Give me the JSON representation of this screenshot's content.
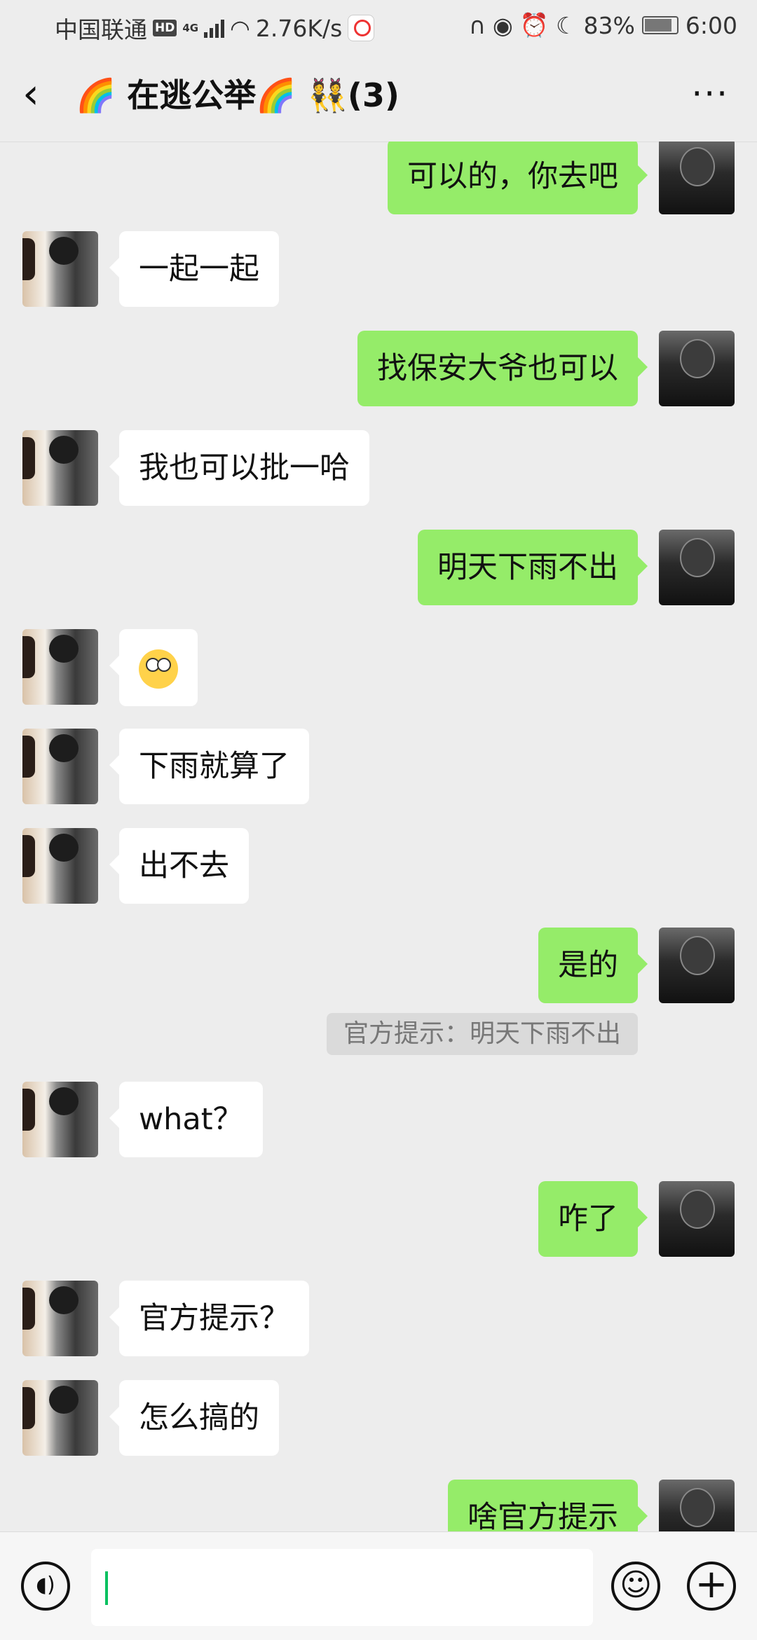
{
  "status_bar": {
    "carrier": "中国联通",
    "hd": "HD",
    "network": "4G",
    "speed": "2.76K/s",
    "battery": "83%",
    "time": "6:00",
    "icons": [
      "headphones-icon",
      "eye-icon",
      "alarm-icon",
      "moon-icon",
      "battery-icon",
      "wifi-icon",
      "signal-icon"
    ]
  },
  "nav": {
    "back_icon": "‹",
    "title": "🌈 在逃公举🌈 👯(3)",
    "more_icon": "···"
  },
  "messages": [
    {
      "side": "right",
      "text": "可以的，你去吧"
    },
    {
      "side": "left",
      "text": "一起一起"
    },
    {
      "side": "right",
      "text": "找保安大爷也可以"
    },
    {
      "side": "left",
      "text": "我也可以批一哈"
    },
    {
      "side": "right",
      "text": "明天下雨不出"
    },
    {
      "side": "left",
      "emoji": "eye-roll-emoji"
    },
    {
      "side": "left",
      "text": "下雨就算了"
    },
    {
      "side": "left",
      "text": "出不去"
    },
    {
      "side": "right",
      "text": "是的"
    },
    {
      "side": "left",
      "text": "what？"
    },
    {
      "side": "right",
      "text": "咋了"
    },
    {
      "side": "left",
      "text": "官方提示？"
    },
    {
      "side": "left",
      "text": "怎么搞的"
    },
    {
      "side": "right",
      "text": "啥官方提示"
    }
  ],
  "system_notice": "官方提示：明天下雨不出",
  "input_bar": {
    "voice_icon": "voice-icon",
    "emoji_icon": "emoji-icon",
    "plus_icon": "plus-icon",
    "input_value": ""
  },
  "colors": {
    "background": "#ededed",
    "self_bubble": "#95ec69",
    "other_bubble": "#ffffff",
    "caret": "#07c160"
  }
}
